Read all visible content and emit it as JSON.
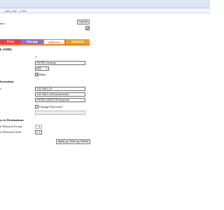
{
  "browser": {
    "url": "...._path_conp..._1.html"
  },
  "header": {
    "title_fragment": "ator",
    "logout_label": "Log out",
    "refresh_icon": "refresh-icon"
  },
  "tabs": [
    {
      "label": "Print",
      "color": "#e8385a"
    },
    {
      "label": "Storage",
      "color": "#8b6fd1"
    },
    {
      "label": "Address",
      "color": "#f07a28"
    },
    {
      "label": "Network",
      "color": "#f0a020"
    }
  ],
  "colors": {
    "tab_bar": "#f26a2b",
    "active_tab_bg": "#ffffff",
    "active_tab_text": "#f07a28"
  },
  "form": {
    "section1_title": "k (SMB)",
    "number_value": "1",
    "name_field_value": "PATRE-Desktop",
    "type_select_value": "ABC",
    "main_label": "Main",
    "main_checked": true,
    "section2_title": "formation",
    "row_label": "s",
    "ip_value": "192.168.0.20",
    "path_value": "192.168.0.20/Scans/Kemia",
    "user_value": "PATRE-DESKTOP/Scanner",
    "change_password_label": "Change Password",
    "change_password_checked": false,
    "password_value": ""
  },
  "access": {
    "section_title": "ss to Destinations",
    "group_label": "e Allowed Group",
    "group_value": "1",
    "level_label": "e Allowed Level",
    "level_value": "1"
  },
  "buttons": {
    "apply": "Apply",
    "clear": "Clear",
    "cancel": "Cancel"
  }
}
